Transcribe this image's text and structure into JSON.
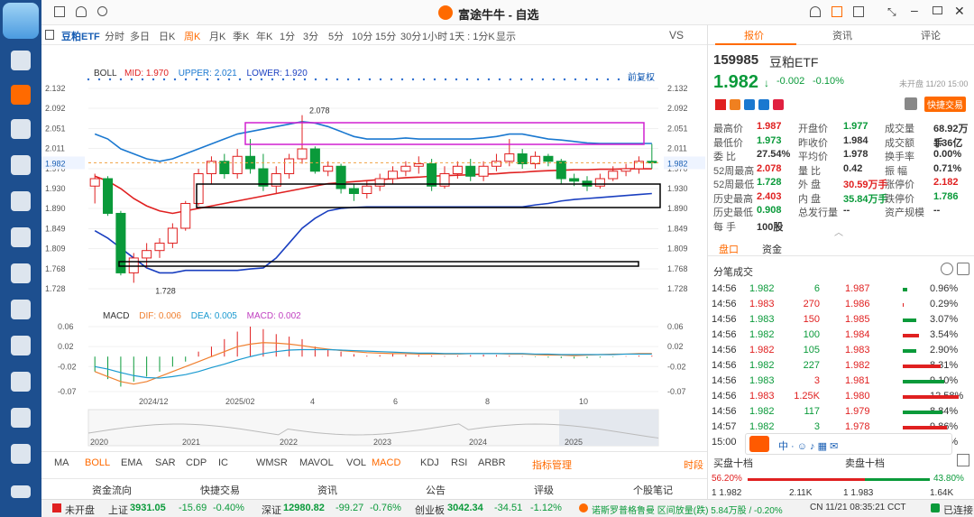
{
  "window": {
    "title": "富途牛牛 - 自选"
  },
  "toolbar": {
    "symbol": "豆粕ETF",
    "periods": [
      "分时",
      "多日",
      "日K",
      "周K",
      "月K",
      "季K",
      "年K",
      "1分",
      "3分",
      "5分",
      "10分",
      "15分",
      "30分",
      "1小时",
      "1天 : 1分K",
      "显示"
    ],
    "active_period": "周K",
    "vs": "VS"
  },
  "boll": {
    "label": "BOLL",
    "mid_label": "MID:",
    "mid": "1.970",
    "upper_label": "UPPER:",
    "upper": "2.021",
    "lower_label": "LOWER:",
    "lower": "1.920",
    "adj": "前复权"
  },
  "macd": {
    "label": "MACD",
    "dif_label": "DIF:",
    "dif": "0.006",
    "dea_label": "DEA:",
    "dea": "0.005",
    "macd_label": "MACD:",
    "macd": "0.002"
  },
  "chart_data": {
    "type": "candlestick",
    "price_axis": [
      "2.132",
      "2.092",
      "2.051",
      "2.011",
      "1.970",
      "1.930",
      "1.890",
      "1.849",
      "1.809",
      "1.768",
      "1.728"
    ],
    "current_price_tag": "1.982",
    "high_label": "2.078",
    "low_label": "1.728",
    "x_labels": [
      "2024/12",
      "2025/02",
      "4",
      "6",
      "8",
      "10"
    ],
    "macd_axis": [
      "0.06",
      "0.02",
      "-0.02",
      "-0.07"
    ],
    "overview_years": [
      "2020",
      "2021",
      "2022",
      "2023",
      "2024",
      "2025"
    ],
    "candles": [
      [
        1.935,
        1.95,
        1.9,
        1.96
      ],
      [
        1.95,
        1.88,
        1.875,
        1.955
      ],
      [
        1.88,
        1.76,
        1.755,
        1.885
      ],
      [
        1.76,
        1.79,
        1.74,
        1.8
      ],
      [
        1.79,
        1.805,
        1.77,
        1.82
      ],
      [
        1.805,
        1.82,
        1.79,
        1.83
      ],
      [
        1.82,
        1.85,
        1.81,
        1.86
      ],
      [
        1.85,
        1.9,
        1.845,
        1.905
      ],
      [
        1.9,
        1.96,
        1.895,
        1.97
      ],
      [
        1.96,
        1.985,
        1.94,
        1.995
      ],
      [
        1.985,
        1.96,
        1.95,
        2.0
      ],
      [
        1.96,
        1.995,
        1.95,
        2.01
      ],
      [
        1.995,
        1.97,
        1.96,
        2.03
      ],
      [
        1.97,
        1.935,
        1.925,
        2.0
      ],
      [
        1.935,
        1.96,
        1.92,
        1.975
      ],
      [
        1.96,
        1.99,
        1.95,
        2.0
      ],
      [
        1.99,
        2.01,
        1.98,
        2.078
      ],
      [
        2.01,
        1.965,
        1.96,
        2.015
      ],
      [
        1.965,
        1.975,
        1.955,
        1.985
      ],
      [
        1.975,
        1.93,
        1.92,
        1.98
      ],
      [
        1.93,
        1.92,
        1.905,
        1.94
      ],
      [
        1.92,
        1.935,
        1.91,
        1.945
      ],
      [
        1.935,
        1.95,
        1.925,
        1.96
      ],
      [
        1.95,
        1.965,
        1.94,
        1.975
      ],
      [
        1.965,
        1.975,
        1.955,
        1.985
      ],
      [
        1.975,
        1.98,
        1.96,
        1.995
      ],
      [
        1.98,
        1.935,
        1.925,
        1.99
      ],
      [
        1.935,
        1.96,
        1.93,
        1.975
      ],
      [
        1.96,
        1.975,
        1.95,
        1.985
      ],
      [
        1.975,
        1.955,
        1.945,
        1.99
      ],
      [
        1.955,
        1.975,
        1.945,
        1.985
      ],
      [
        1.975,
        1.985,
        1.965,
        2.0
      ],
      [
        1.985,
        2.0,
        1.975,
        2.03
      ],
      [
        2.0,
        1.98,
        1.97,
        2.01
      ],
      [
        1.98,
        1.995,
        1.97,
        2.005
      ],
      [
        1.995,
        1.985,
        1.975,
        2.0
      ],
      [
        1.985,
        1.95,
        1.94,
        1.99
      ],
      [
        1.95,
        1.945,
        1.935,
        1.96
      ],
      [
        1.945,
        1.935,
        1.925,
        1.955
      ],
      [
        1.935,
        1.95,
        1.93,
        1.96
      ],
      [
        1.95,
        1.965,
        1.945,
        1.975
      ],
      [
        1.965,
        1.97,
        1.955,
        1.98
      ],
      [
        1.97,
        1.985,
        1.96,
        1.995
      ],
      [
        1.985,
        1.982,
        1.97,
        2.02
      ]
    ],
    "boll_upper": [
      2.04,
      2.03,
      2.01,
      2.0,
      1.99,
      1.985,
      1.99,
      2.0,
      2.01,
      2.02,
      2.03,
      2.04,
      2.045,
      2.05,
      2.055,
      2.06,
      2.065,
      2.062,
      2.055,
      2.045,
      2.035,
      2.03,
      2.03,
      2.03,
      2.032,
      2.03,
      2.03,
      2.03,
      2.03,
      2.03,
      2.032,
      2.035,
      2.04,
      2.04,
      2.035,
      2.03,
      2.028,
      2.025,
      2.022,
      2.021,
      2.021,
      2.021,
      2.021,
      2.021
    ],
    "boll_mid": [
      1.955,
      1.945,
      1.93,
      1.91,
      1.895,
      1.885,
      1.88,
      1.885,
      1.89,
      1.895,
      1.9,
      1.905,
      1.91,
      1.915,
      1.92,
      1.925,
      1.93,
      1.935,
      1.94,
      1.942,
      1.944,
      1.946,
      1.948,
      1.95,
      1.952,
      1.953,
      1.955,
      1.956,
      1.957,
      1.958,
      1.959,
      1.96,
      1.962,
      1.963,
      1.965,
      1.966,
      1.967,
      1.968,
      1.968,
      1.969,
      1.969,
      1.97,
      1.97,
      1.97
    ],
    "boll_lower": [
      1.845,
      1.83,
      1.81,
      1.79,
      1.77,
      1.76,
      1.76,
      1.765,
      1.765,
      1.765,
      1.765,
      1.765,
      1.768,
      1.77,
      1.79,
      1.82,
      1.85,
      1.87,
      1.885,
      1.89,
      1.892,
      1.893,
      1.893,
      1.893,
      1.893,
      1.893,
      1.893,
      1.893,
      1.893,
      1.893,
      1.893,
      1.893,
      1.893,
      1.893,
      1.897,
      1.9,
      1.905,
      1.908,
      1.91,
      1.912,
      1.914,
      1.916,
      1.918,
      1.92
    ],
    "macd_hist": [
      -0.03,
      -0.045,
      -0.06,
      -0.05,
      -0.04,
      -0.03,
      -0.02,
      -0.01,
      0.01,
      0.02,
      0.035,
      0.05,
      0.06,
      0.055,
      0.045,
      0.04,
      0.035,
      0.02,
      0.015,
      0.01,
      0.005,
      0.002,
      0.003,
      0.005,
      0.004,
      0.003,
      0.002,
      0.001,
      0.002,
      0.003,
      0.004,
      0.003,
      0.002,
      0.001,
      -0.001,
      -0.002,
      -0.003,
      -0.004,
      -0.003,
      -0.002,
      -0.001,
      0.001,
      0.002,
      0.002
    ],
    "dif": [
      -0.03,
      -0.04,
      -0.05,
      -0.055,
      -0.05,
      -0.04,
      -0.03,
      -0.02,
      -0.01,
      0.0,
      0.01,
      0.02,
      0.025,
      0.028,
      0.027,
      0.025,
      0.022,
      0.018,
      0.015,
      0.012,
      0.01,
      0.008,
      0.007,
      0.006,
      0.006,
      0.005,
      0.005,
      0.005,
      0.005,
      0.006,
      0.006,
      0.006,
      0.005,
      0.005,
      0.004,
      0.003,
      0.003,
      0.002,
      0.003,
      0.004,
      0.005,
      0.005,
      0.006,
      0.006
    ],
    "dea": [
      -0.02,
      -0.025,
      -0.032,
      -0.038,
      -0.042,
      -0.043,
      -0.04,
      -0.036,
      -0.03,
      -0.022,
      -0.015,
      -0.007,
      0.0,
      0.006,
      0.01,
      0.013,
      0.014,
      0.014,
      0.014,
      0.013,
      0.012,
      0.011,
      0.01,
      0.009,
      0.008,
      0.007,
      0.007,
      0.006,
      0.006,
      0.006,
      0.006,
      0.006,
      0.006,
      0.006,
      0.005,
      0.005,
      0.004,
      0.004,
      0.004,
      0.004,
      0.004,
      0.005,
      0.005,
      0.005
    ]
  },
  "indicators": [
    "MA",
    "BOLL",
    "EMA",
    "SAR",
    "CDP",
    "IC",
    "WMSR",
    "MAVOL",
    "VOL",
    "MACD",
    "KDJ",
    "RSI",
    "ARBR",
    "指标管理",
    "时段"
  ],
  "bottom_tabs": [
    "资金流向",
    "快捷交易",
    "资讯",
    "公告",
    "评级",
    "个股笔记"
  ],
  "quote": {
    "tabs": [
      "报价",
      "资讯",
      "评论"
    ],
    "code": "159985",
    "name": "豆粕ETF",
    "price": "1.982",
    "change": "-0.002",
    "pct": "-0.10%",
    "status": "未开盘 11/20 15:00",
    "quick_trade": "快捷交易",
    "fields": [
      [
        "最高价",
        "1.987",
        "开盘价",
        "1.977",
        "成交量",
        "68.92万手"
      ],
      [
        "最低价",
        "1.973",
        "昨收价",
        "1.984",
        "成交额",
        "1.36亿"
      ],
      [
        "委 比",
        "27.54%",
        "平均价",
        "1.978",
        "换手率",
        "0.00%"
      ],
      [
        "52周最高",
        "2.078",
        "量 比",
        "0.42",
        "振 幅",
        "0.71%"
      ],
      [
        "52周最低",
        "1.728",
        "外 盘",
        "30.59万手",
        "涨停价",
        "2.182"
      ],
      [
        "历史最高",
        "2.403",
        "内 盘",
        "35.84万手",
        "跌停价",
        "1.786"
      ],
      [
        "历史最低",
        "0.908",
        "总发行量",
        "--",
        "资产规模",
        "--"
      ],
      [
        "每 手",
        "100股",
        "",
        "",
        "",
        ""
      ]
    ],
    "subtabs": [
      "盘口",
      "资金"
    ],
    "trades_title": "分笔成交",
    "trades": [
      [
        "14:56",
        "1.982",
        "6",
        "1.987",
        "0.96%"
      ],
      [
        "14:56",
        "1.983",
        "270",
        "1.986",
        "0.29%"
      ],
      [
        "14:56",
        "1.983",
        "150",
        "1.985",
        "3.07%"
      ],
      [
        "14:56",
        "1.982",
        "100",
        "1.984",
        "3.54%"
      ],
      [
        "14:56",
        "1.982",
        "105",
        "1.983",
        "2.90%"
      ],
      [
        "14:56",
        "1.982",
        "227",
        "1.982",
        "8.31%"
      ],
      [
        "14:56",
        "1.983",
        "3",
        "1.981",
        "9.10%"
      ],
      [
        "14:56",
        "1.983",
        "1.25K",
        "1.980",
        "12.58%"
      ],
      [
        "14:56",
        "1.982",
        "117",
        "1.979",
        "8.84%"
      ],
      [
        "14:57",
        "1.982",
        "3",
        "1.978",
        "9.86%"
      ],
      [
        "15:00",
        "1.9",
        "",
        "",
        "4.62%"
      ]
    ],
    "buy_title": "买盘十档",
    "sell_title": "卖盘十档",
    "buy_pct": "56.20%",
    "sell_pct": "43.80%",
    "bottom_row": [
      "1 1.982",
      "2.11K",
      "1 1.983",
      "1.64K"
    ]
  },
  "status": {
    "market_state": "未开盘",
    "sh_label": "上证",
    "sh": "3931.05",
    "sh_chg": "-15.69",
    "sh_pct": "-0.40%",
    "sz_label": "深证",
    "sz": "12980.82",
    "sz_chg": "-99.27",
    "sz_pct": "-0.76%",
    "cy_label": "创业板",
    "cy": "3042.34",
    "cy_chg": "-34.51",
    "cy_pct": "-1.12%",
    "news": "诺斯罗普格鲁曼 区间放量(跌) 5.84万股 / -0.20%",
    "time": "CN 11/21 08:35:21 CCT",
    "conn": "已连接"
  }
}
